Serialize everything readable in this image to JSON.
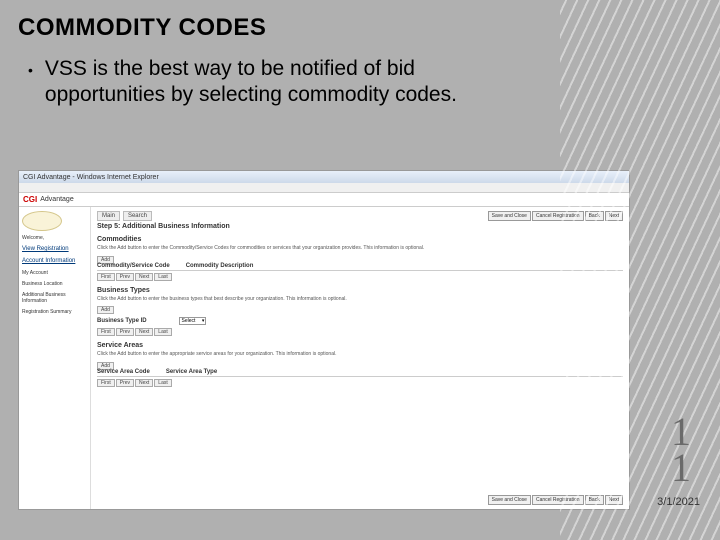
{
  "title": "COMMODITY CODES",
  "bullet": "VSS is the best way to be notified of bid opportunities by selecting commodity codes.",
  "page_number_top": "1",
  "page_number_bottom": "1",
  "date": "3/1/2021",
  "screenshot": {
    "window_title": "CGI Advantage - Windows Internet Explorer",
    "brand": "CGI",
    "brand_sub": "Advantage",
    "sidebar": {
      "welcome": "Welcome,",
      "links": [
        "View Registration",
        "Account Information"
      ],
      "sections": [
        "My Account",
        "Business Location",
        "Additional Business Information",
        "Registration Summary"
      ]
    },
    "tabs": [
      "Main",
      "Search"
    ],
    "step": "Step 5: Additional Business Information",
    "nav_buttons": [
      "Save and Close",
      "Cancel Registration",
      "Back",
      "Next"
    ],
    "sections": {
      "commodities": {
        "title": "Commodities",
        "desc": "Click the Add button to enter the Commodity/Service Codes for commodities or services that your organization provides. This information is optional.",
        "act_btn": "Add",
        "cols": [
          "Commodity/Service Code",
          "Commodity Description"
        ],
        "row_btns": [
          "First",
          "Prev",
          "Next",
          "Last"
        ]
      },
      "business_types": {
        "title": "Business Types",
        "desc": "Click the Add button to enter the business types that best describe your organization. This information is optional.",
        "act_btn": "Add",
        "field": "Business Type ID",
        "select": "Select",
        "row_btns": [
          "First",
          "Prev",
          "Next",
          "Last"
        ]
      },
      "service_areas": {
        "title": "Service Areas",
        "desc": "Click the Add button to enter the appropriate service areas for your organization. This information is optional.",
        "act_btn": "Add",
        "cols": [
          "Service Area Code",
          "Service Area Type"
        ],
        "row_btns": [
          "First",
          "Prev",
          "Next",
          "Last"
        ]
      }
    }
  }
}
